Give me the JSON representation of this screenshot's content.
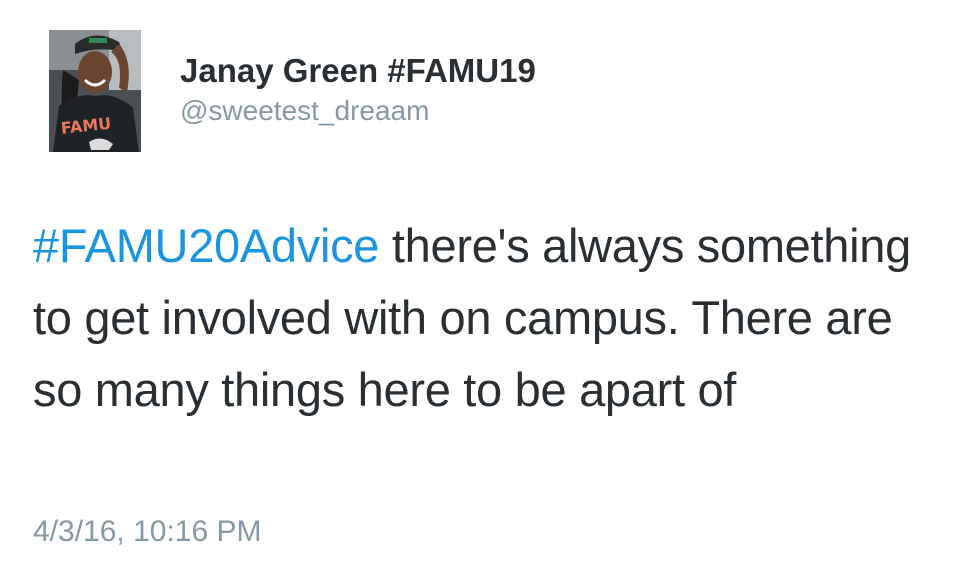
{
  "author": {
    "display_name": "Janay Green  #FAMU19",
    "handle": "@sweetest_dreaam",
    "avatar_alt": "profile photo",
    "avatar_shirt_text": "FAMU"
  },
  "tweet": {
    "hashtag": "#FAMU20Advice",
    "body": " there's always something to get involved with on campus. There are so many things here to be apart of",
    "timestamp": "4/3/16, 10:16 PM"
  },
  "colors": {
    "hashtag": "#1b95e0",
    "text": "#292f33",
    "muted": "#8899a6"
  }
}
